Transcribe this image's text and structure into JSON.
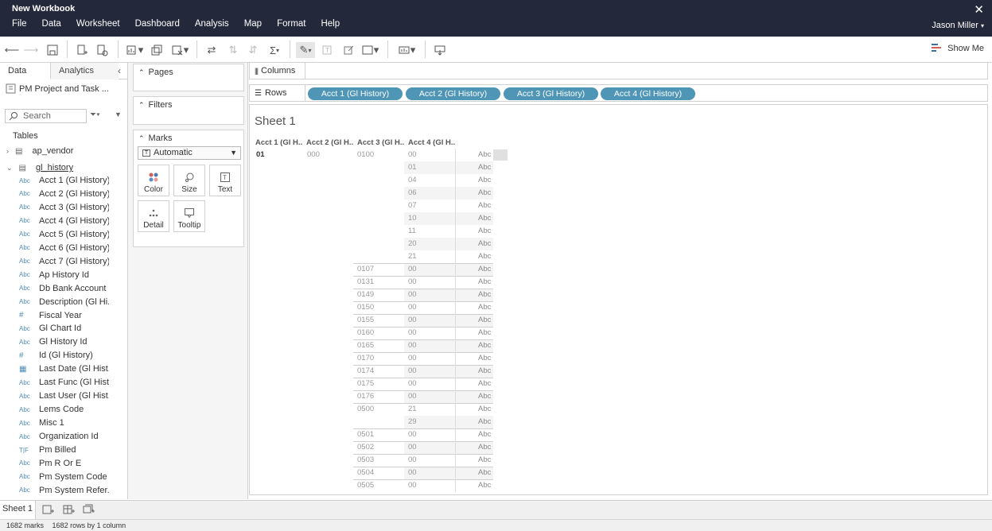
{
  "window": {
    "title": "New Workbook",
    "user": "Jason Miller"
  },
  "menu": [
    "File",
    "Data",
    "Worksheet",
    "Dashboard",
    "Analysis",
    "Map",
    "Format",
    "Help"
  ],
  "toolbar": {
    "show_me": "Show Me"
  },
  "data_pane": {
    "tabs": [
      "Data",
      "Analytics"
    ],
    "datasource": "PM Project and Task ...",
    "search_placeholder": "Search",
    "tables_heading": "Tables",
    "tables": [
      "ap_vendor",
      "gl_history"
    ],
    "fields": [
      {
        "type": "Abc",
        "name": "Acct 1 (Gl History)"
      },
      {
        "type": "Abc",
        "name": "Acct 2 (Gl History)"
      },
      {
        "type": "Abc",
        "name": "Acct 3 (Gl History)"
      },
      {
        "type": "Abc",
        "name": "Acct 4 (Gl History)"
      },
      {
        "type": "Abc",
        "name": "Acct 5 (Gl History)"
      },
      {
        "type": "Abc",
        "name": "Acct 6 (Gl History)"
      },
      {
        "type": "Abc",
        "name": "Acct 7 (Gl History)"
      },
      {
        "type": "Abc",
        "name": "Ap History Id"
      },
      {
        "type": "Abc",
        "name": "Db Bank Account Id"
      },
      {
        "type": "Abc",
        "name": "Description (Gl Hi..."
      },
      {
        "type": "#",
        "name": "Fiscal Year"
      },
      {
        "type": "Abc",
        "name": "Gl Chart Id"
      },
      {
        "type": "Abc",
        "name": "Gl History Id"
      },
      {
        "type": "#",
        "name": "Id (Gl History)"
      },
      {
        "type": "date",
        "name": "Last Date (Gl Hist..."
      },
      {
        "type": "Abc",
        "name": "Last Func (Gl Hist..."
      },
      {
        "type": "Abc",
        "name": "Last User (Gl Hist..."
      },
      {
        "type": "Abc",
        "name": "Lems Code"
      },
      {
        "type": "Abc",
        "name": "Misc 1"
      },
      {
        "type": "Abc",
        "name": "Organization Id"
      },
      {
        "type": "T|F",
        "name": "Pm Billed"
      },
      {
        "type": "Abc",
        "name": "Pm R Or E"
      },
      {
        "type": "Abc",
        "name": "Pm System Code"
      },
      {
        "type": "Abc",
        "name": "Pm System Refer..."
      }
    ]
  },
  "cards": {
    "pages": "Pages",
    "filters": "Filters",
    "marks": "Marks",
    "mark_type": "Automatic",
    "mark_buttons": [
      "Color",
      "Size",
      "Text",
      "Detail",
      "Tooltip"
    ]
  },
  "shelves": {
    "columns": "Columns",
    "rows": "Rows",
    "row_pills": [
      "Acct 1 (Gl History)",
      "Acct 2 (Gl History)",
      "Acct 3 (Gl History)",
      "Acct 4 (Gl History)"
    ]
  },
  "sheet": {
    "title": "Sheet 1",
    "headers": [
      "Acct 1 (Gl H..",
      "Acct 2 (Gl H..",
      "Acct 3 (Gl H..",
      "Acct 4 (Gl H.."
    ],
    "acct1": "01",
    "acct2": "000",
    "rows": [
      {
        "a3": "0100",
        "a4": "00"
      },
      {
        "a3": "",
        "a4": "01"
      },
      {
        "a3": "",
        "a4": "04"
      },
      {
        "a3": "",
        "a4": "06"
      },
      {
        "a3": "",
        "a4": "07"
      },
      {
        "a3": "",
        "a4": "10"
      },
      {
        "a3": "",
        "a4": "11"
      },
      {
        "a3": "",
        "a4": "20"
      },
      {
        "a3": "",
        "a4": "21"
      },
      {
        "a3": "0107",
        "a4": "00"
      },
      {
        "a3": "0131",
        "a4": "00"
      },
      {
        "a3": "0149",
        "a4": "00"
      },
      {
        "a3": "0150",
        "a4": "00"
      },
      {
        "a3": "0155",
        "a4": "00"
      },
      {
        "a3": "0160",
        "a4": "00"
      },
      {
        "a3": "0165",
        "a4": "00"
      },
      {
        "a3": "0170",
        "a4": "00"
      },
      {
        "a3": "0174",
        "a4": "00"
      },
      {
        "a3": "0175",
        "a4": "00"
      },
      {
        "a3": "0176",
        "a4": "00"
      },
      {
        "a3": "0500",
        "a4": "21"
      },
      {
        "a3": "",
        "a4": "29"
      },
      {
        "a3": "0501",
        "a4": "00"
      },
      {
        "a3": "0502",
        "a4": "00"
      },
      {
        "a3": "0503",
        "a4": "00"
      },
      {
        "a3": "0504",
        "a4": "00"
      },
      {
        "a3": "0505",
        "a4": "00"
      }
    ],
    "mark_label": "Abc"
  },
  "bottom": {
    "sheet_tab": "Sheet 1"
  },
  "status": {
    "marks": "1682 marks",
    "rows": "1682 rows by 1 column"
  }
}
